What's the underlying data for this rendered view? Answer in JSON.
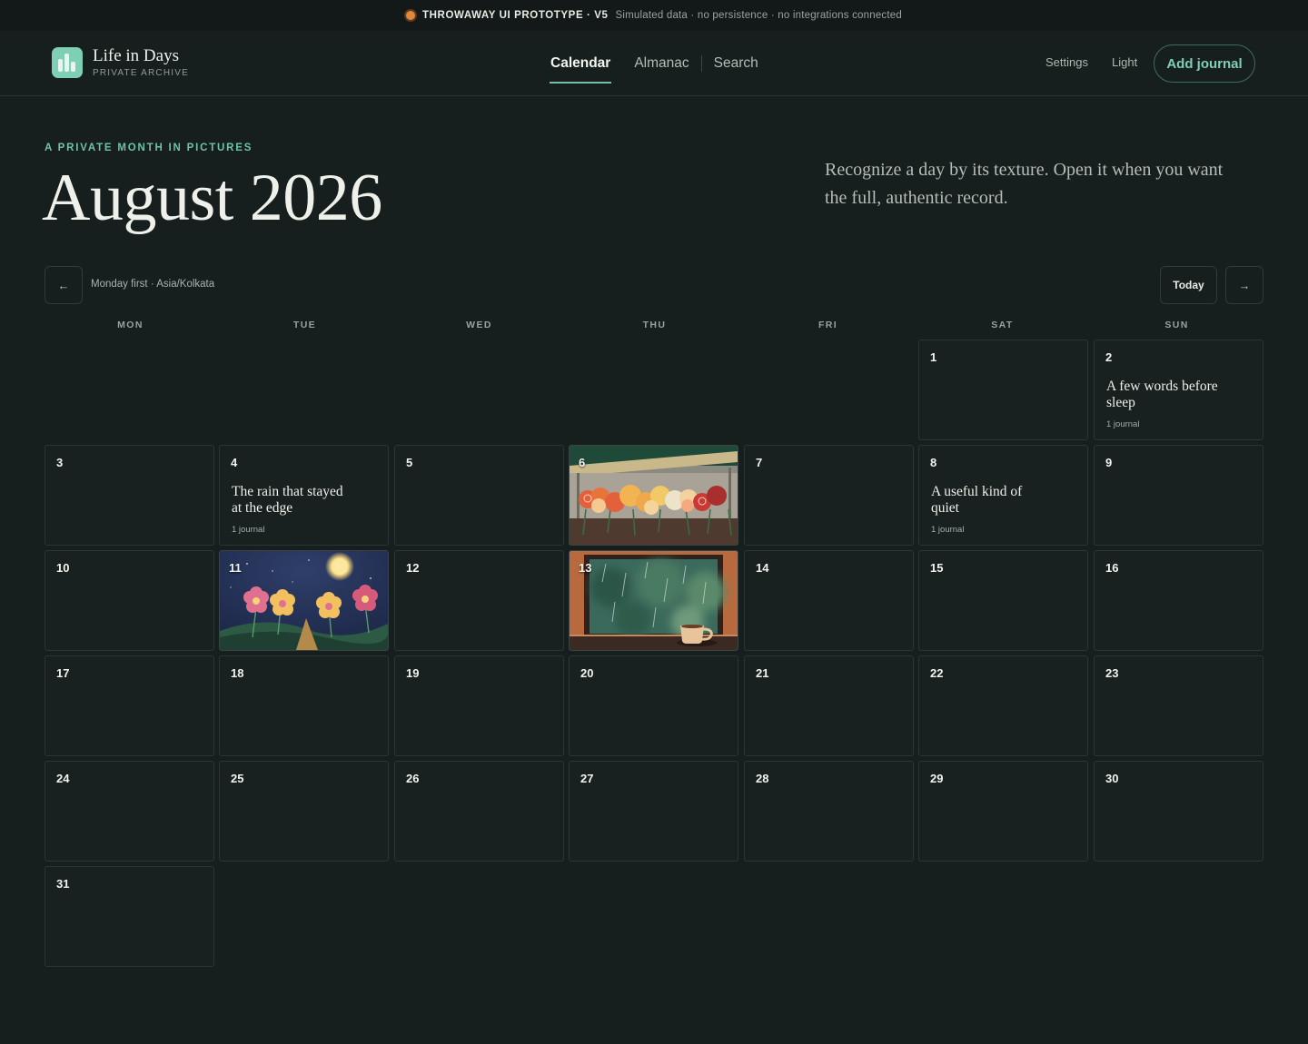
{
  "banner": {
    "tag": "THROWAWAY UI PROTOTYPE · V5",
    "note": "Simulated data · no persistence · no integrations connected"
  },
  "brand": {
    "title": "Life in Days",
    "subtitle": "PRIVATE ARCHIVE",
    "accent": "#7fcfb5"
  },
  "nav": {
    "calendar": "Calendar",
    "almanac": "Almanac",
    "search": "Search"
  },
  "header": {
    "settings": "Settings",
    "theme": "Light",
    "add_journal": "Add journal"
  },
  "hero": {
    "eyebrow": "A PRIVATE MONTH IN PICTURES",
    "title": "August 2026",
    "tagline": "Recognize a day by its texture. Open it when you want the full, authentic record."
  },
  "calendar": {
    "prev_icon": "arrow-left-icon",
    "next_icon": "arrow-right-icon",
    "meta": "Monday first · Asia/Kolkata",
    "today": "Today",
    "weekdays": [
      "MON",
      "TUE",
      "WED",
      "THU",
      "FRI",
      "SAT",
      "SUN"
    ],
    "days": [
      {
        "d": "1"
      },
      {
        "d": "2",
        "title": "A few words before sleep",
        "count": "1 journal"
      },
      {
        "d": "3"
      },
      {
        "d": "4",
        "title": "The rain that stayed at the edge",
        "count": "1 journal"
      },
      {
        "d": "5"
      },
      {
        "d": "6",
        "image": "flower-stall-illustration"
      },
      {
        "d": "7"
      },
      {
        "d": "8",
        "title": "A useful kind of quiet",
        "count": "1 journal"
      },
      {
        "d": "9"
      },
      {
        "d": "10"
      },
      {
        "d": "11",
        "image": "night-flowers-moon-illustration"
      },
      {
        "d": "12"
      },
      {
        "d": "13",
        "image": "rainy-window-coffee-illustration"
      },
      {
        "d": "14"
      },
      {
        "d": "15"
      },
      {
        "d": "16"
      },
      {
        "d": "17"
      },
      {
        "d": "18"
      },
      {
        "d": "19"
      },
      {
        "d": "20"
      },
      {
        "d": "21"
      },
      {
        "d": "22"
      },
      {
        "d": "23"
      },
      {
        "d": "24"
      },
      {
        "d": "25"
      },
      {
        "d": "26"
      },
      {
        "d": "27"
      },
      {
        "d": "28"
      },
      {
        "d": "29"
      },
      {
        "d": "30"
      },
      {
        "d": "31"
      }
    ]
  }
}
